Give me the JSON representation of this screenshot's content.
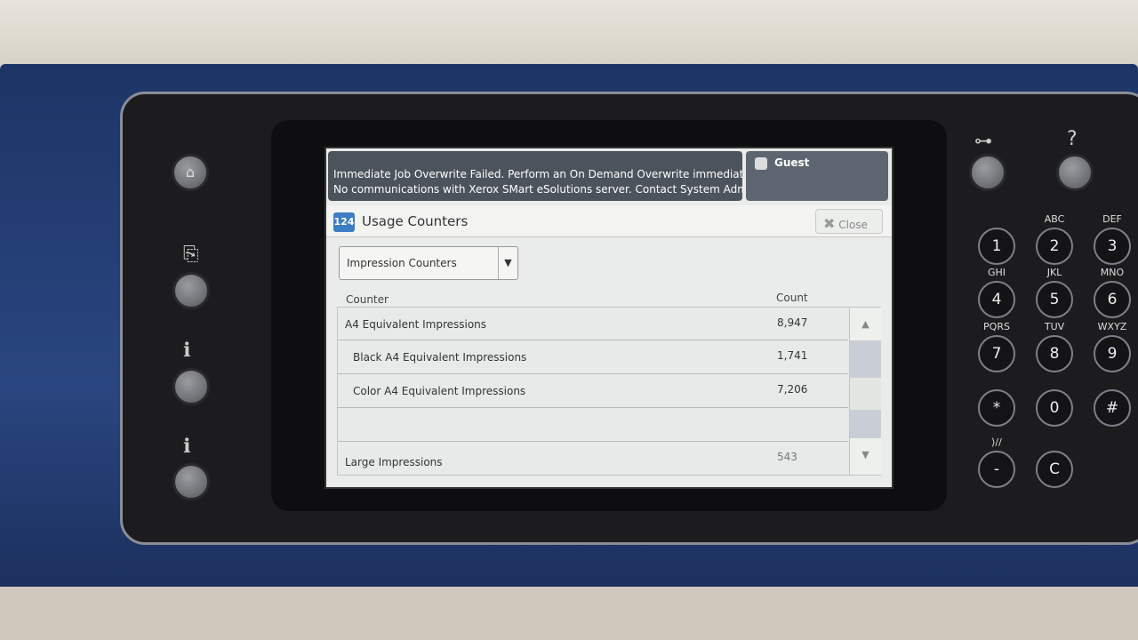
{
  "status": {
    "messages": [
      "Immediate Job Overwrite Failed.  Perform an On Demand Overwrite immediately.",
      "No communications with Xerox SMart eSolutions server. Contact System Administr..."
    ],
    "user": "Guest"
  },
  "window": {
    "icon_text": "124",
    "title": "Usage Counters",
    "close_label": "Close"
  },
  "selector": {
    "selected": "Impression Counters"
  },
  "table": {
    "headers": {
      "counter": "Counter",
      "count": "Count"
    },
    "rows": [
      {
        "name": "A4 Equivalent Impressions",
        "count": "8,947"
      },
      {
        "name": "Black A4 Equivalent Impressions",
        "count": "1,741"
      },
      {
        "name": "Color A4 Equivalent Impressions",
        "count": "7,206"
      },
      {
        "name": "",
        "count": ""
      },
      {
        "name": "Large Impressions",
        "count": "543"
      }
    ]
  },
  "keypad": {
    "top": [
      "⊶",
      "?"
    ],
    "keys": [
      {
        "k": "1",
        "l": ""
      },
      {
        "k": "2",
        "l": "ABC"
      },
      {
        "k": "3",
        "l": "DEF"
      },
      {
        "k": "4",
        "l": "GHI"
      },
      {
        "k": "5",
        "l": "JKL"
      },
      {
        "k": "6",
        "l": "MNO"
      },
      {
        "k": "7",
        "l": "PQRS"
      },
      {
        "k": "8",
        "l": "TUV"
      },
      {
        "k": "9",
        "l": "WXYZ"
      },
      {
        "k": "*",
        "l": ""
      },
      {
        "k": "0",
        "l": ""
      },
      {
        "k": "#",
        "l": ""
      },
      {
        "k": "-",
        "l": "⟩//"
      },
      {
        "k": "C",
        "l": ""
      }
    ]
  },
  "side_buttons": [
    "home-icon",
    "services-icon",
    "job-status-icon",
    "machine-status-icon"
  ],
  "colors": {
    "panel": "#2a4680",
    "bezel": "#1c1c1e",
    "status_bar": "#4b535c",
    "title_icon": "#3c7dc4"
  }
}
